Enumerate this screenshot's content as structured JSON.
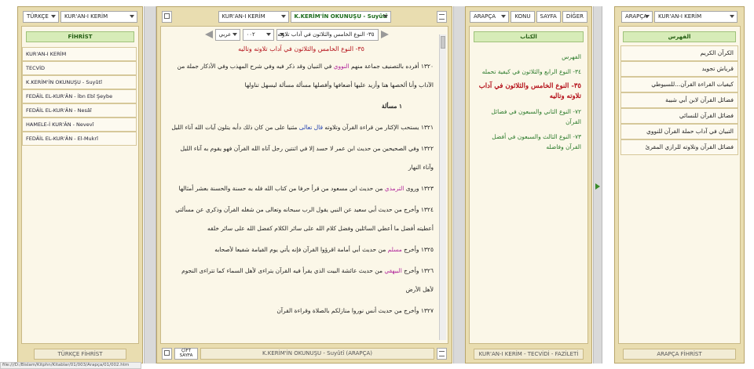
{
  "panel1": {
    "lang_select": "TÜRKÇE",
    "book_select": "KUR'AN-I KERİM",
    "header": "FİHRİST",
    "items": [
      "KUR'AN-I KERİM",
      "TECVİD",
      "K.KERİM'İN OKUNUŞU - Suyûtî",
      "FEDÂİL EL-KUR'ÂN - İbn Ebî Şeybe",
      "FEDÂİL EL-KUR'ÂN - Nesâî",
      "HAMELE-İ KUR'ÂN - Nevevî",
      "FEDÂİL EL-KUR'ÂN - El-Mukrî"
    ],
    "footer_button": "TÜRKÇE FİHRİST"
  },
  "panel2": {
    "book_select": "KUR'AN-I KERİM",
    "chapter_select": "K.KERİM'İN OKUNUŞU - Suyûtî",
    "nav_title": "٣٥- النوع الخامس والثلاثون في آداب تلاوته",
    "page_select": "٠٠٢",
    "lang_select": "عربي",
    "heading": "٣٥- النوع الخامس والثلاثون في آداب تلاوته وتاليه",
    "paragraphs": [
      {
        "pre": "١٣٢٠ أفرده بالتصنيف جماعة منهم ",
        "hl": "النووي",
        "hl_color": "pink",
        "post": " في التبيان وقد ذكر فيه وفي شرح المهذب وفي الأذكار جملة من الآداب وأنا ألخصها هنا وأزيد عليها أضعافها وأفصلها مسألة مسألة ليسهل تناولها"
      },
      {
        "pre": "١ مسألة",
        "hl": "",
        "hl_color": "",
        "post": ""
      },
      {
        "pre": "١٣٢١ يستحب الإكثار من قراءة القرآن وتلاوته ",
        "hl": "قال تعالى",
        "hl_color": "blue",
        "post": " مثنيا على من كان ذلك دأبه يتلون آيات الله آناء الليل"
      },
      {
        "pre": "١٣٢٢ وفي الصحيحين من حديث ابن عمر لا حسد إلا في اثنتين رجل آتاه الله القرآن فهو يقوم به آناء الليل وآناء النهار",
        "hl": "",
        "hl_color": "",
        "post": ""
      },
      {
        "pre": "١٣٢٣ وروى ",
        "hl": "الترمذي",
        "hl_color": "pink",
        "post": " من حديث ابن مسعود من قرأ حرفا من كتاب الله فله به حسنة والحسنة بعشر أمثالها"
      },
      {
        "pre": "١٣٢٤ وأخرج من حديث أبي سعيد عن النبي يقول الرب سبحانه وتعالى من شغله القرآن وذكري عن مسألتي أعطيته أفضل ما أعطي السائلين وفضل كلام الله على سائر الكلام كفضل الله على سائر خلقه",
        "hl": "",
        "hl_color": "",
        "post": ""
      },
      {
        "pre": "١٣٢٥ وأخرج ",
        "hl": "مسلم",
        "hl_color": "pink",
        "post": " من حديث أبي أمامة اقرؤوا القرآن فإنه يأتي يوم القيامة شفيعا لأصحابه"
      },
      {
        "pre": "١٣٢٦ وأخرج ",
        "hl": "البيهقي",
        "hl_color": "pink",
        "post": " من حديث عائشة البيت الذي يقرأ فيه القرآن يتراءى لأهل السماء كما تتراءى النجوم لأهل الأرض"
      },
      {
        "pre": "١٣٢٧ وأخرج من حديث أنس نوروا منازلكم بالصلاة وقراءة القرآن",
        "hl": "",
        "hl_color": "",
        "post": ""
      }
    ],
    "footer_split": "ÇİFT SAYFA",
    "footer_title": "K.KERİM'İN OKUNUŞU - Suyûtî (ARAPÇA)"
  },
  "panel3": {
    "lang_select": "ARAPÇA",
    "tab_konu": "KONU",
    "tab_sayfa": "SAYFA",
    "tab_diger": "DİĞER",
    "header": "الكتاب",
    "toc": [
      {
        "text": "الفهرس",
        "style": "green"
      },
      {
        "text": "٣٤- النوع الرابع والثلاثون في كيفية تحمله",
        "style": "green"
      },
      {
        "text": "٣٥- النوع الخامس والثلاثون في آداب تلاوته وتاليه",
        "style": "red"
      },
      {
        "text": "٧٢- النوع الثاني والسبعون في فضائل القرآن",
        "style": "green"
      },
      {
        "text": "٧٣- النوع الثالث والسبعون في أفضل القرآن وفاضله",
        "style": "green"
      }
    ],
    "footer_title": "KUR'AN-I KERİM - TECVİDİ - FAZİLETİ"
  },
  "panel4": {
    "lang_select": "ARAPÇA",
    "book_select": "KUR'AN-I KERİM",
    "header": "الفهرس",
    "items": [
      "الكرآن الكريم",
      "قرياش تجويد",
      "كيفيات القراءة القرآن...للسيوطي",
      "فضائل القرآن لابن أبي شيبة",
      "فضائل القرآن للنسائي",
      "التبيان في آداب حملة القرآن للنووي",
      "فضائل القرآن وتلاوته للرازي المقرئ"
    ],
    "footer_button": "ARAPÇA FİHRİST"
  },
  "statusbar": "file:///D:/Bislam/Kitphn/Kitablar/01/003/Arapça/01/002.htm"
}
